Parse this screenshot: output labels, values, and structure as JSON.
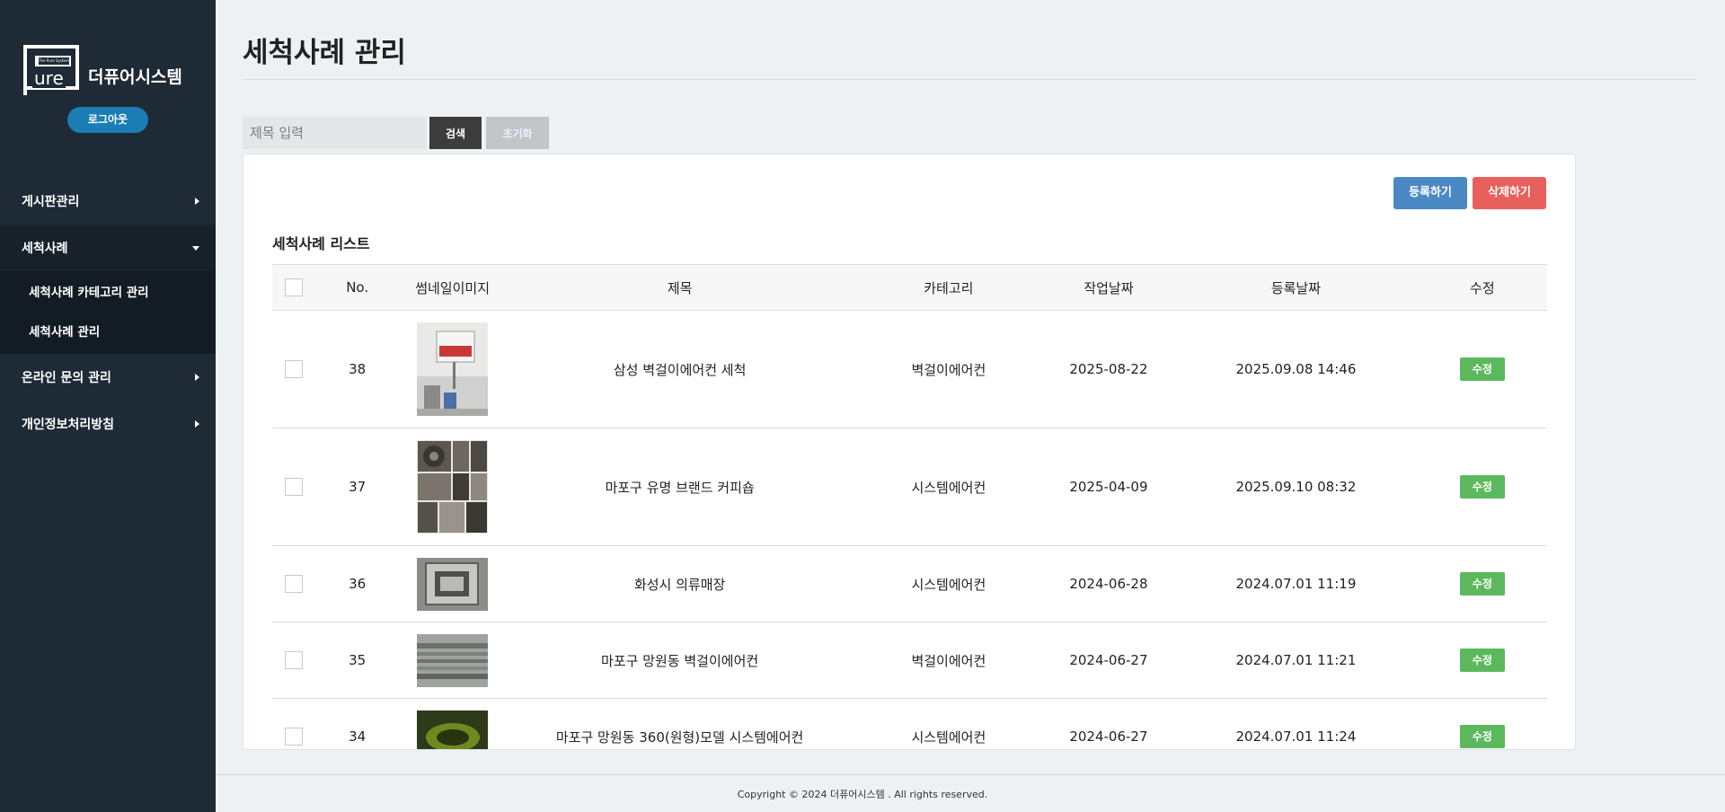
{
  "sidebar": {
    "logo_word": "ure",
    "logo_tag": "The Pure System",
    "brand": "더퓨어시스템",
    "logout_label": "로그아웃",
    "menu": [
      {
        "label": "게시판관리"
      },
      {
        "label": "세척사례",
        "sub": [
          "세척사례 카테고리 관리",
          "세척사례 관리"
        ]
      },
      {
        "label": "온라인 문의 관리"
      },
      {
        "label": "개인정보처리방침"
      }
    ]
  },
  "page": {
    "title": "세척사례 관리",
    "search": {
      "placeholder": "제목 입력",
      "search_label": "검색",
      "reset_label": "초기화"
    },
    "register_label": "등록하기",
    "delete_label": "삭제하기",
    "list_title": "세척사례 리스트"
  },
  "table": {
    "headers": [
      "",
      "No.",
      "썸네일이미지",
      "제목",
      "카테고리",
      "작업날짜",
      "등록날짜",
      "수정"
    ],
    "edit_label": "수정",
    "rows": [
      {
        "no": "38",
        "title": "삼성 벽걸이에어컨 세척",
        "category": "벽걸이에어컨",
        "work_date": "2025-08-22",
        "reg_date": "2025.09.08 14:46",
        "thumb": "aircon-wall-photo"
      },
      {
        "no": "37",
        "title": "마포구 유명 브랜드 커피숍",
        "category": "시스템에어컨",
        "work_date": "2025-04-09",
        "reg_date": "2025.09.10 08:32",
        "thumb": "collage-photo"
      },
      {
        "no": "36",
        "title": "화성시 의류매장",
        "category": "시스템에어컨",
        "work_date": "2024-06-28",
        "reg_date": "2024.07.01 11:19",
        "thumb": "system-aircon-photo"
      },
      {
        "no": "35",
        "title": "마포구 망원동 벽걸이에어컨",
        "category": "벽걸이에어컨",
        "work_date": "2024-06-27",
        "reg_date": "2024.07.01 11:21",
        "thumb": "wall-grille-photo"
      },
      {
        "no": "34",
        "title": "마포구 망원동 360(원형)모델 시스템에어컨",
        "category": "시스템에어컨",
        "work_date": "2024-06-27",
        "reg_date": "2024.07.01 11:24",
        "thumb": "round-model-photo"
      }
    ]
  },
  "footer": {
    "copyright": "Copyright © 2024 더퓨어시스템 . All rights reserved."
  },
  "colors": {
    "sidebar": "#1e2a35",
    "logout": "#1a7db3",
    "register": "#4b89c4",
    "delete": "#e8605c",
    "edit": "#5cb85c",
    "search": "#3c3c3c"
  }
}
